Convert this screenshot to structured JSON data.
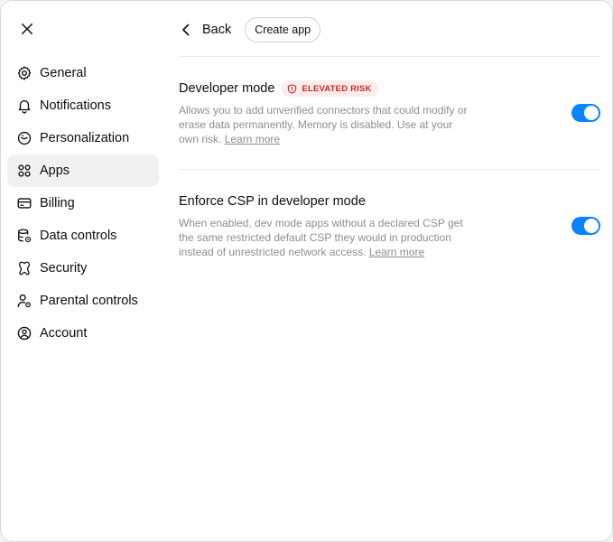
{
  "sidebar": {
    "items": [
      {
        "label": "General",
        "icon": "gear-icon"
      },
      {
        "label": "Notifications",
        "icon": "bell-icon"
      },
      {
        "label": "Personalization",
        "icon": "personalization-icon"
      },
      {
        "label": "Apps",
        "icon": "apps-grid-icon",
        "active": true
      },
      {
        "label": "Billing",
        "icon": "card-icon"
      },
      {
        "label": "Data controls",
        "icon": "database-gear-icon"
      },
      {
        "label": "Security",
        "icon": "security-icon"
      },
      {
        "label": "Parental controls",
        "icon": "person-gear-icon"
      },
      {
        "label": "Account",
        "icon": "user-circle-icon"
      }
    ]
  },
  "topbar": {
    "back_label": "Back",
    "create_label": "Create app"
  },
  "settings": {
    "developer_mode": {
      "title": "Developer mode",
      "badge": "ELEVATED RISK",
      "description": "Allows you to add unverified connectors that could modify or erase data permanently. Memory is disabled. Use at your own risk.",
      "link": "Learn more",
      "enabled": true
    },
    "enforce_csp": {
      "title": "Enforce CSP in developer mode",
      "description": "When enabled, dev mode apps without a declared CSP get the same restricted default CSP they would in production instead of unrestricted network access.",
      "link": "Learn more",
      "enabled": true
    }
  },
  "colors": {
    "accent": "#0a84ff",
    "risk_text": "#c62828",
    "risk_bg": "#fdecec",
    "active_nav_bg": "#f1f1f1"
  }
}
